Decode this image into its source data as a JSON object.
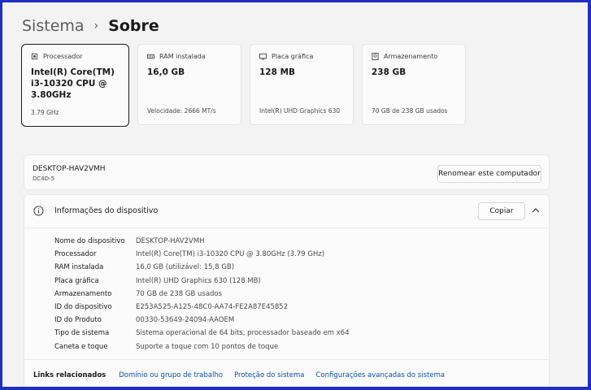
{
  "breadcrumb": {
    "parent": "Sistema",
    "separator": "›",
    "current": "Sobre"
  },
  "cards": [
    {
      "label": "Processador",
      "value": "Intel(R) Core(TM) i3-10320 CPU @ 3.80GHz",
      "sub": "3.79 GHz",
      "icon": "processor-icon"
    },
    {
      "label": "RAM instalada",
      "value": "16,0 GB",
      "sub": "Velocidade: 2666 MT/s",
      "icon": "ram-icon"
    },
    {
      "label": "Placa gráfica",
      "value": "128 MB",
      "sub": "Intel(R) UHD Graphics 630",
      "icon": "graphics-card-icon"
    },
    {
      "label": "Armazenamento",
      "value": "238 GB",
      "sub": "70 GB de 238 GB usados",
      "icon": "storage-icon"
    }
  ],
  "device": {
    "name": "DESKTOP-HAV2VMH",
    "code": "DC4D-5",
    "rename_label": "Renomear este computador"
  },
  "info": {
    "title": "Informações do dispositivo",
    "copy_label": "Copiar",
    "rows": [
      {
        "label": "Nome do dispositivo",
        "value": "DESKTOP-HAV2VMH"
      },
      {
        "label": "Processador",
        "value": "Intel(R) Core(TM) i3-10320 CPU @ 3.80GHz (3.79 GHz)"
      },
      {
        "label": "RAM instalada",
        "value": "16,0 GB (utilizável: 15,8 GB)"
      },
      {
        "label": "Placa gráfica",
        "value": "Intel(R) UHD Graphics 630 (128 MB)"
      },
      {
        "label": "Armazenamento",
        "value": "70 GB de 238 GB usados"
      },
      {
        "label": "ID do dispositivo",
        "value": "E253A525-A125-48C0-AA74-FE2A87E45852"
      },
      {
        "label": "ID do Produto",
        "value": "00330-53649-24094-AAOEM"
      },
      {
        "label": "Tipo de sistema",
        "value": "Sistema operacional de 64 bits, processador baseado em x64"
      },
      {
        "label": "Caneta e toque",
        "value": "Suporte a toque com 10 pontos de toque"
      }
    ]
  },
  "related": {
    "title": "Links relacionados",
    "links": [
      "Domínio ou grupo de trabalho",
      "Proteção do sistema",
      "Configurações avançadas do sistema"
    ]
  },
  "colors": {
    "frame": "#1f2fbf",
    "link": "#0b4fa8",
    "background": "#f3f3f3"
  }
}
